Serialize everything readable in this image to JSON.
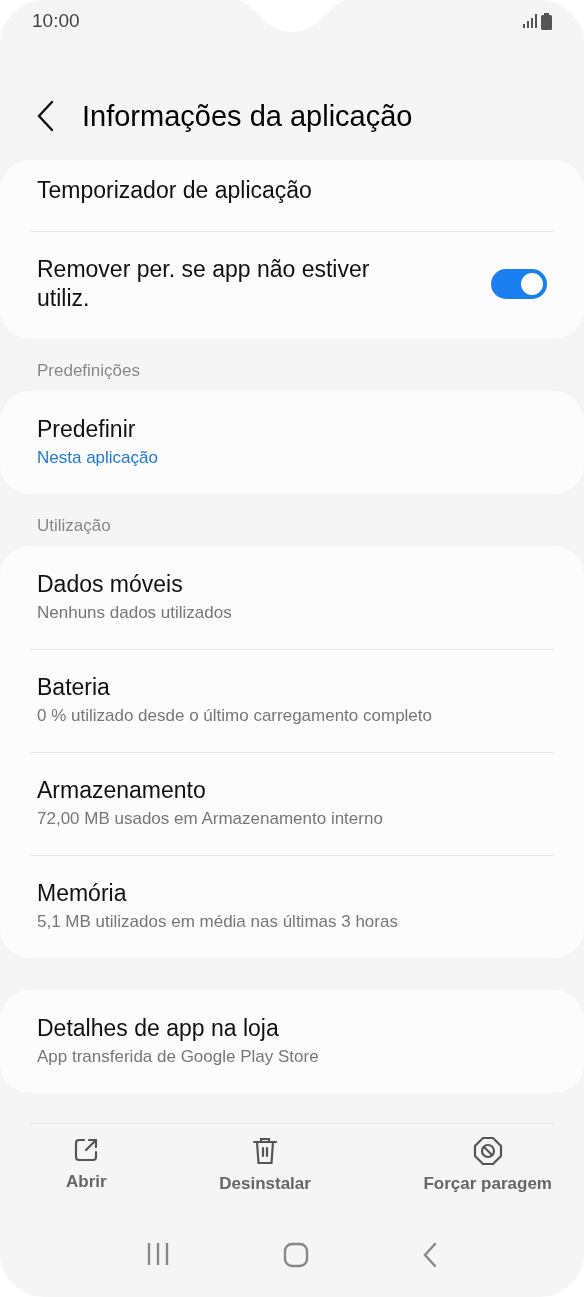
{
  "status_bar": {
    "time": "10:00"
  },
  "header": {
    "title": "Informações da aplicação"
  },
  "groups": [
    {
      "items": [
        {
          "kind": "text",
          "title": "Temporizador de aplicação"
        },
        {
          "kind": "toggle",
          "title": "Remover per. se app não estiver utiliz.",
          "on": true
        }
      ]
    },
    {
      "header": "Predefinições",
      "items": [
        {
          "kind": "text",
          "title": "Predefinir",
          "subtitle": "Nesta aplicação",
          "accent": true
        }
      ]
    },
    {
      "header": "Utilização",
      "items": [
        {
          "kind": "text",
          "title": "Dados móveis",
          "subtitle": "Nenhuns dados utilizados",
          "accent": false
        },
        {
          "kind": "text",
          "title": "Bateria",
          "subtitle": "0 % utilizado desde o último carregamento completo",
          "accent": false
        },
        {
          "kind": "text",
          "title": "Armazenamento",
          "subtitle": "72,00 MB usados em Armazenamento interno",
          "accent": false
        },
        {
          "kind": "text",
          "title": "Memória",
          "subtitle": "5,1 MB utilizados em média nas últimas 3 horas",
          "accent": false
        }
      ]
    },
    {
      "items": [
        {
          "kind": "text",
          "title": "Detalhes de app na loja",
          "subtitle": "App transferida de Google Play Store",
          "accent": false
        }
      ]
    }
  ],
  "actions": [
    {
      "kind": "open",
      "label": "Abrir"
    },
    {
      "kind": "trash",
      "label": "Desinstalar"
    },
    {
      "kind": "stop",
      "label": "Forçar paragem"
    }
  ]
}
